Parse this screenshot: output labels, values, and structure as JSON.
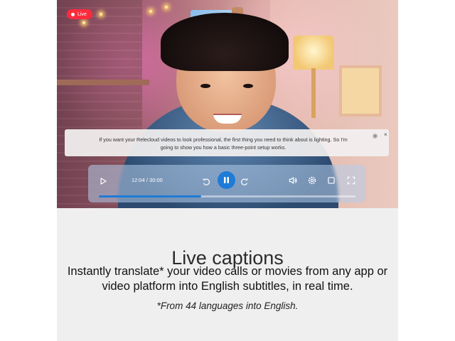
{
  "video": {
    "live_badge": "Live",
    "caption": "If you want your Relecloud videos to look professional, the first thing you need to think about is lighting. So I'm going to show you how a basic three-point setup works.",
    "caption_settings_icon": "gear-icon",
    "caption_close_label": "×"
  },
  "player": {
    "time": "12:04 / 30:00",
    "progress": 0.4,
    "icons": [
      "play-icon",
      "rewind-icon",
      "pause-icon",
      "forward-icon",
      "volume-icon",
      "gear-icon",
      "picture-in-picture-icon",
      "fullscreen-icon"
    ],
    "accent_color": "#1e7bd7"
  },
  "content": {
    "headline": "Live captions",
    "body": "Instantly translate* your video calls or movies from any app or video platform into English subtitles, in real time.",
    "footnote": "*From 44 languages into English."
  }
}
